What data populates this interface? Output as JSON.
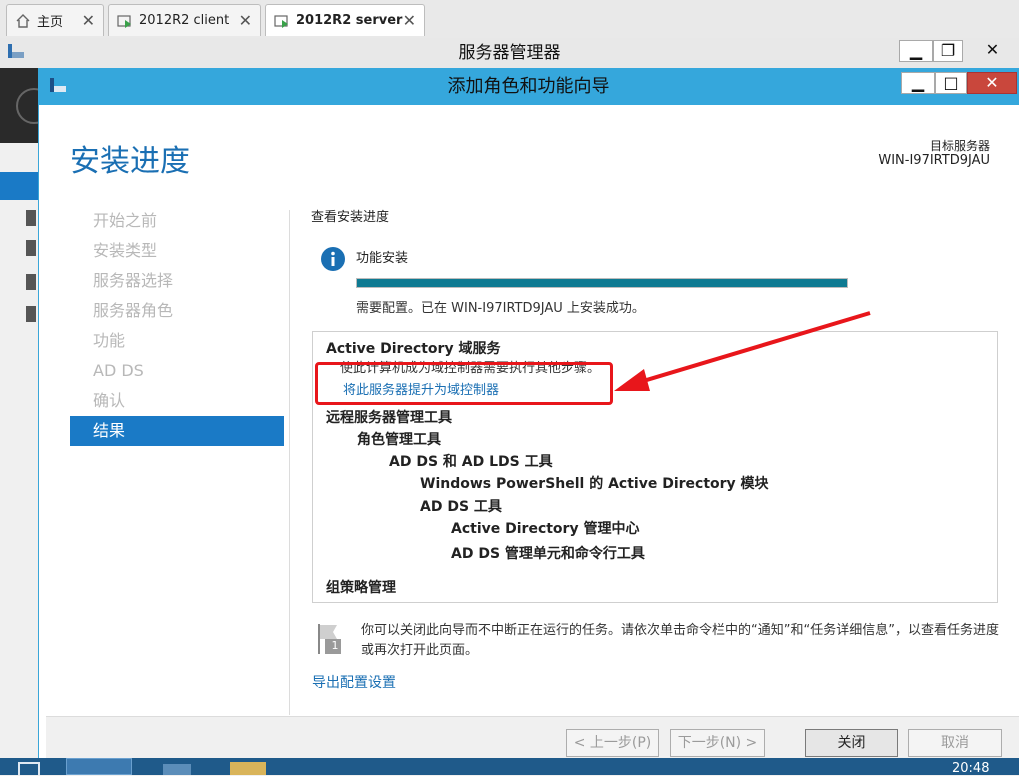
{
  "browser_tabs": [
    {
      "label": "主页",
      "icon": "home-icon"
    },
    {
      "label": "2012R2 client",
      "icon": "vm-icon"
    },
    {
      "label": "2012R2 server",
      "icon": "vm-icon"
    }
  ],
  "server_manager": {
    "title": "服务器管理器"
  },
  "wizard": {
    "title": "添加角色和功能向导",
    "page_title": "安装进度",
    "target_server_label": "目标服务器",
    "target_server_name": "WIN-I97IRTD9JAU",
    "nav_items": [
      "开始之前",
      "安装类型",
      "服务器选择",
      "服务器角色",
      "功能",
      "AD DS",
      "确认",
      "结果"
    ],
    "section_heading": "查看安装进度",
    "feature_install_label": "功能安装",
    "progress_fraction": 1.0,
    "status_text": "需要配置。已在 WIN-I97IRTD9JAU 上安装成功。",
    "results": {
      "adds_title": "Active Directory 域服务",
      "adds_desc": "使此计算机成为域控制器需要执行其他步骤。",
      "promote_link": "将此服务器提升为域控制器",
      "tree": [
        "远程服务器管理工具",
        "角色管理工具",
        "AD DS 和 AD LDS 工具",
        "Windows PowerShell 的 Active Directory 模块",
        "AD DS 工具",
        "Active Directory 管理中心",
        "AD DS 管理单元和命令行工具",
        "组策略管理"
      ]
    },
    "note_text": "你可以关闭此向导而不中断正在运行的任务。请依次单击命令栏中的“通知”和“任务详细信息”，以查看任务进度或再次打开此页面。",
    "note_badge": "1",
    "export_link": "导出配置设置",
    "buttons": {
      "prev": "< 上一步(P)",
      "next": "下一步(N) >",
      "close": "关闭",
      "cancel": "取消"
    }
  },
  "taskbar": {
    "clock": "20:48"
  },
  "colors": {
    "accent": "#1a7ac6",
    "titlebar": "#35a7dc",
    "progress": "#0e7a92",
    "annotation": "#e8161b",
    "link": "#1a6fb3"
  }
}
